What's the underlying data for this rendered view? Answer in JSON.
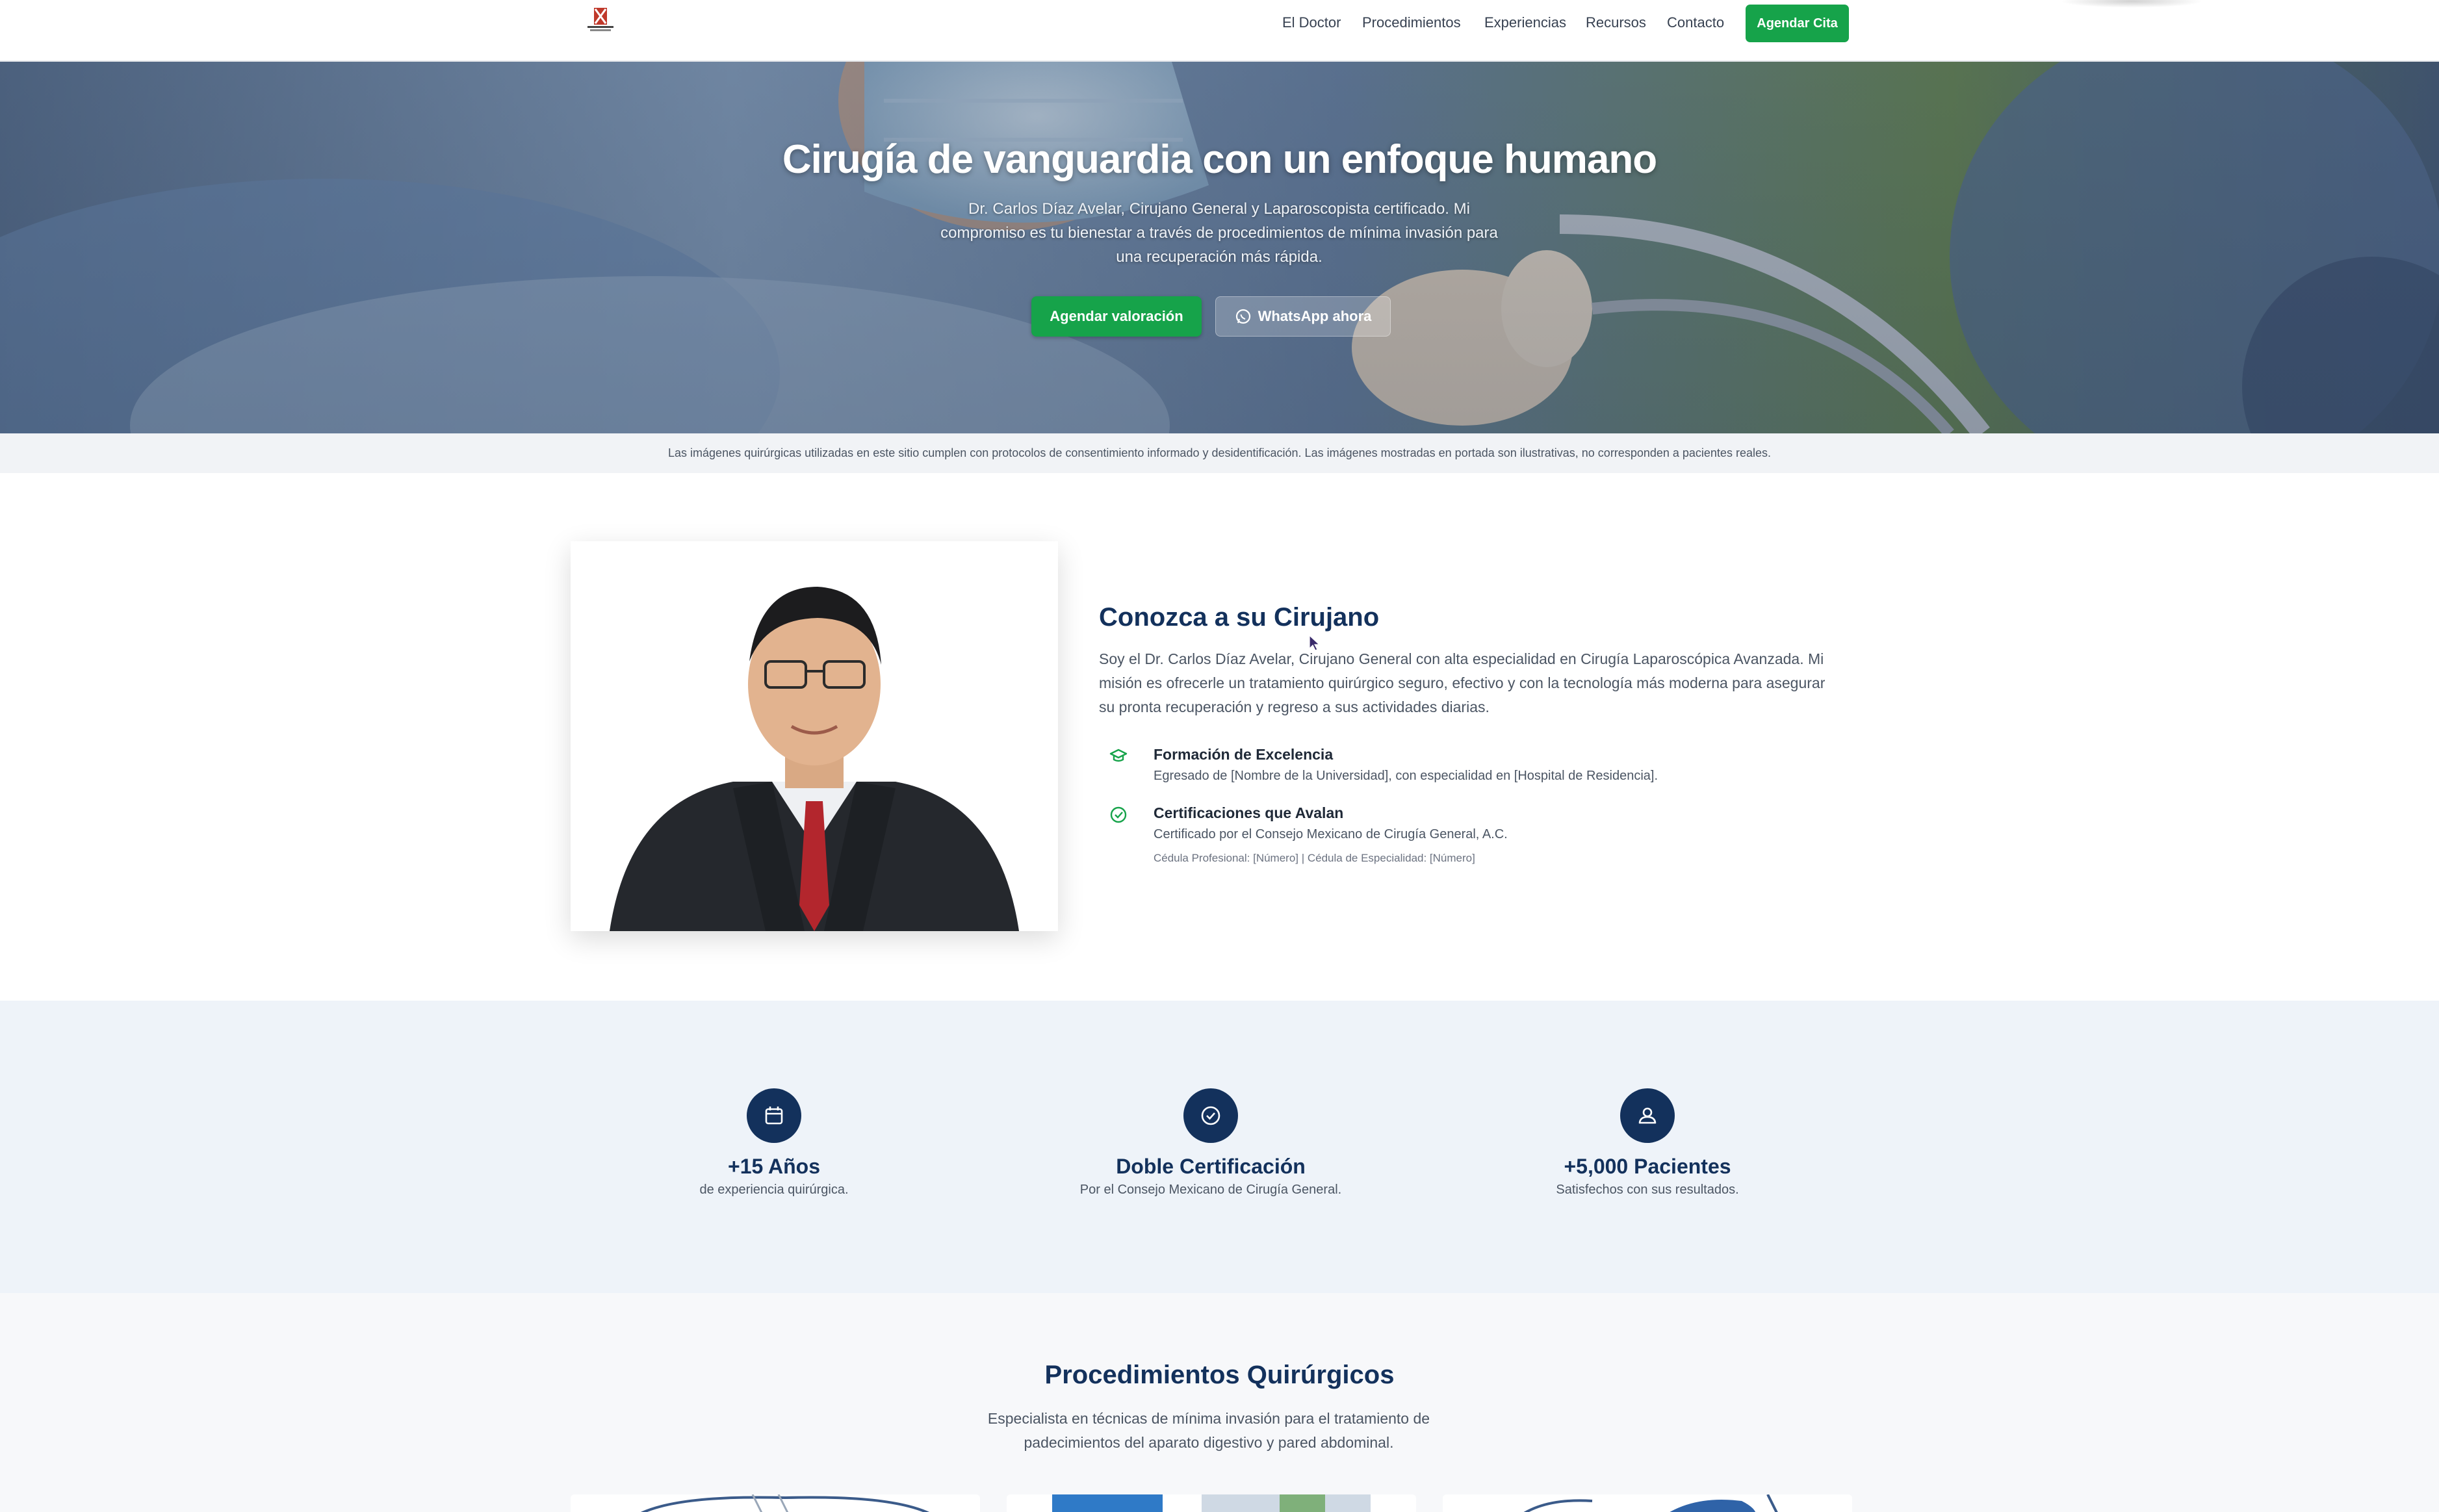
{
  "nav": {
    "links": [
      "El Doctor",
      "Procedimientos",
      "Experiencias",
      "Recursos",
      "Contacto"
    ],
    "cta": "Agendar Cita"
  },
  "hero": {
    "title": "Cirugía de vanguardia con un enfoque humano",
    "subtitle": "Dr. Carlos Díaz Avelar, Cirujano General y Laparoscopista certificado. Mi compromiso es tu bienestar a través de procedimientos de mínima invasión para una recuperación más rápida.",
    "primary_button": "Agendar valoración",
    "secondary_button": "WhatsApp ahora"
  },
  "disclaimer": "Las imágenes quirúrgicas utilizadas en este sitio cumplen con protocolos de consentimiento informado y desidentificación. Las imágenes mostradas en portada son ilustrativas, no corresponden a pacientes reales.",
  "about": {
    "title": "Conozca a su Cirujano",
    "text": "Soy el Dr. Carlos Díaz Avelar, Cirujano General con alta especialidad en Cirugía Laparoscópica Avanzada. Mi misión es ofrecerle un tratamiento quirúrgico seguro, efectivo y con la tecnología más moderna para asegurar su pronta recuperación y regreso a sus actividades diarias.",
    "features": [
      {
        "title": "Formación de Excelencia",
        "desc": "Egresado de [Nombre de la Universidad], con especialidad en [Hospital de Residencia].",
        "icon": "graduation-cap-icon"
      },
      {
        "title": "Certificaciones que Avalan",
        "desc": "Certificado por el Consejo Mexicano de Cirugía General, A.C.",
        "note": "Cédula Profesional: [Número] | Cédula de Especialidad: [Número]",
        "icon": "check-circle-icon"
      }
    ]
  },
  "stats": [
    {
      "value": "+15 Años",
      "label": "de experiencia quirúrgica.",
      "icon": "calendar-icon"
    },
    {
      "value": "Doble Certificación",
      "label": "Por el Consejo Mexicano de Cirugía General.",
      "icon": "check-circle-icon"
    },
    {
      "value": "+5,000 Pacientes",
      "label": "Satisfechos con sus resultados.",
      "icon": "user-icon"
    }
  ],
  "procedures": {
    "title": "Procedimientos Quirúrgicos",
    "subtitle": "Especialista en técnicas de mínima invasión para el tratamiento de padecimientos del aparato digestivo y pared abdominal."
  },
  "colors": {
    "primary_green": "#16a34a",
    "navy": "#13315c",
    "stats_bg": "#eef3f9",
    "disclaimer_bg": "#f1f3f6"
  }
}
